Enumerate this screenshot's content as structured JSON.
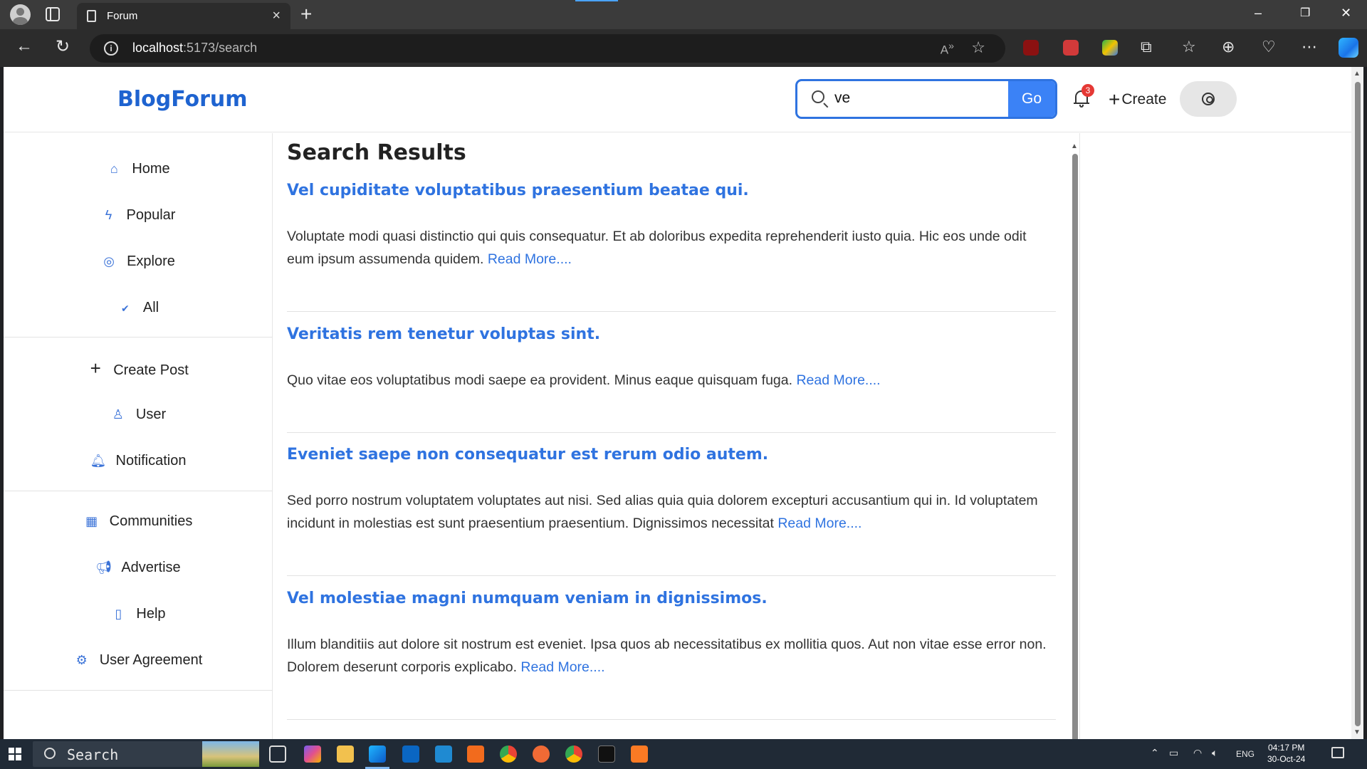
{
  "browser": {
    "tab_title": "Forum",
    "url_host": "localhost",
    "url_path": ":5173/search",
    "read_aloud_label": "A",
    "window_controls": [
      "–",
      "▢",
      "✕"
    ]
  },
  "header": {
    "logo": "BlogForum",
    "search_value": "ve",
    "go_label": "Go",
    "notification_count": "3",
    "create_label": "Create"
  },
  "sidebar": {
    "items": [
      {
        "label": "Home",
        "icon": "home-icon"
      },
      {
        "label": "Popular",
        "icon": "bolt-icon"
      },
      {
        "label": "Explore",
        "icon": "compass-icon"
      },
      {
        "label": "All",
        "icon": "check-icon"
      },
      {
        "label": "Create Post",
        "icon": "plus-icon"
      },
      {
        "label": "User",
        "icon": "user-icon"
      },
      {
        "label": "Notification",
        "icon": "bell-icon"
      },
      {
        "label": "Communities",
        "icon": "building-icon"
      },
      {
        "label": "Advertise",
        "icon": "megaphone-icon"
      },
      {
        "label": "Help",
        "icon": "book-question-icon"
      },
      {
        "label": "User Agreement",
        "icon": "user-cog-icon"
      }
    ]
  },
  "main": {
    "title": "Search Results",
    "posts": [
      {
        "title": "Vel cupiditate voluptatibus praesentium beatae qui.",
        "excerpt": "Voluptate modi quasi distinctio qui quis consequatur. Et ab doloribus expedita reprehenderit iusto quia. Hic eos unde odit eum ipsum assumenda quidem.",
        "read_more": "Read More...."
      },
      {
        "title": "Veritatis rem tenetur voluptas sint.",
        "excerpt": "Quo vitae eos voluptatibus modi saepe ea provident. Minus eaque quisquam fuga.",
        "read_more": "Read More...."
      },
      {
        "title": "Eveniet saepe non consequatur est rerum odio autem.",
        "excerpt": "Sed porro nostrum voluptatem voluptates aut nisi. Sed alias quia quia dolorem excepturi accusantium qui in. Id voluptatem incidunt in molestias est sunt praesentium praesentium. Dignissimos necessitat",
        "read_more": "Read More...."
      },
      {
        "title": "Vel molestiae magni numquam veniam in dignissimos.",
        "excerpt": "Illum blanditiis aut dolore sit nostrum est eveniet. Ipsa quos ab necessitatibus ex mollitia quos. Aut non vitae esse error non. Dolorem deserunt corporis explicabo.",
        "read_more": "Read More...."
      }
    ]
  },
  "taskbar": {
    "search_label": "Search",
    "language": "ENG",
    "time": "04:17 PM",
    "date": "30-Oct-24"
  },
  "colors": {
    "accent": "#2f73e0",
    "go_button": "#3b82f6",
    "badge": "#e53935"
  }
}
